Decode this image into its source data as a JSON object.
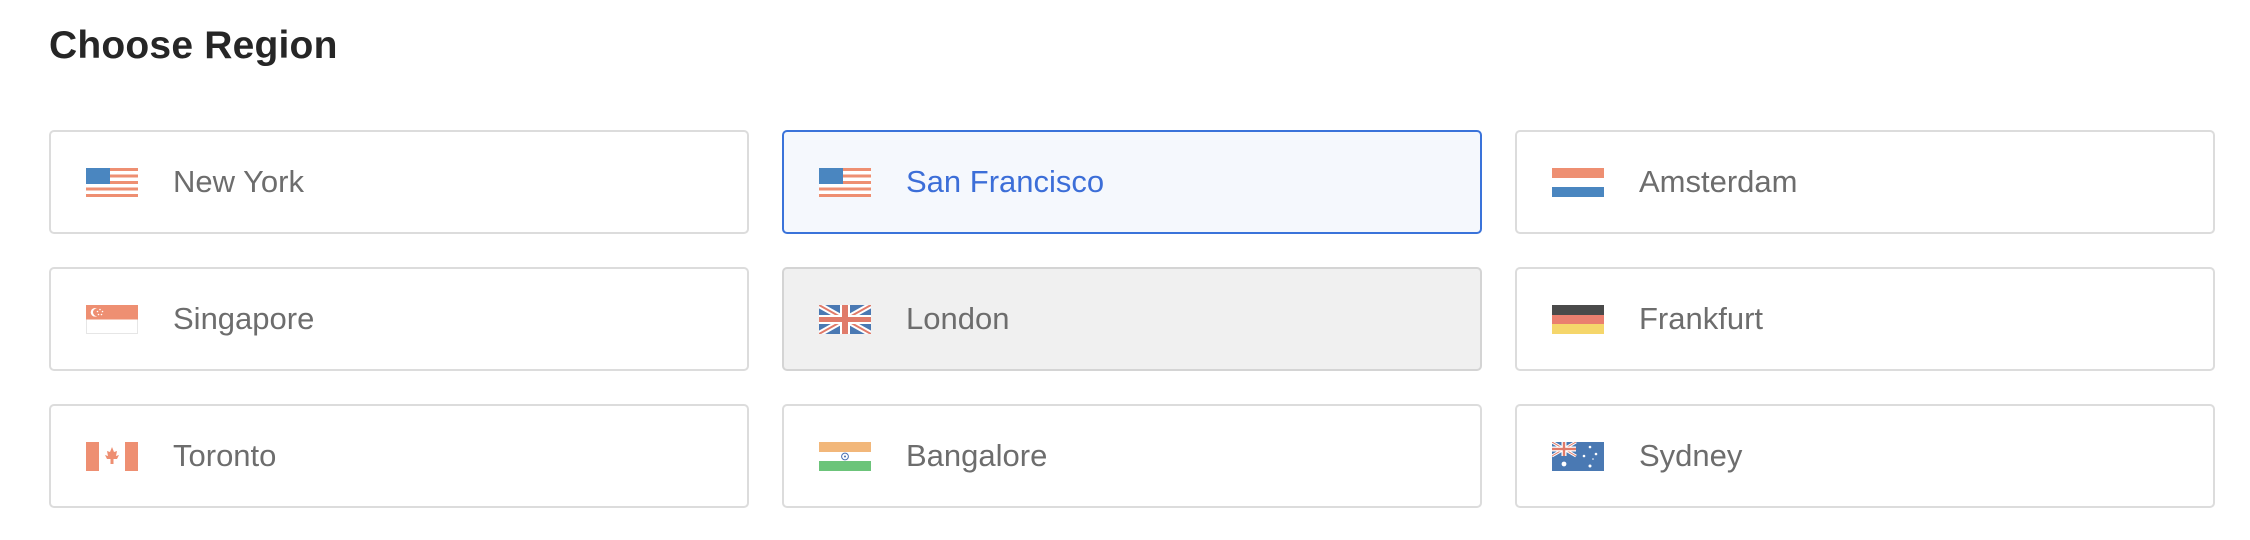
{
  "page": {
    "title": "Choose Region"
  },
  "regions": [
    {
      "label": "New York",
      "flag": "us-flag-icon",
      "state": "default"
    },
    {
      "label": "San Francisco",
      "flag": "us-flag-icon",
      "state": "selected"
    },
    {
      "label": "Amsterdam",
      "flag": "netherlands-flag-icon",
      "state": "default"
    },
    {
      "label": "Singapore",
      "flag": "singapore-flag-icon",
      "state": "default"
    },
    {
      "label": "London",
      "flag": "uk-flag-icon",
      "state": "disabled"
    },
    {
      "label": "Frankfurt",
      "flag": "germany-flag-icon",
      "state": "default"
    },
    {
      "label": "Toronto",
      "flag": "canada-flag-icon",
      "state": "default"
    },
    {
      "label": "Bangalore",
      "flag": "india-flag-icon",
      "state": "default"
    },
    {
      "label": "Sydney",
      "flag": "australia-flag-icon",
      "state": "default"
    }
  ],
  "colors": {
    "selected_border": "#3a73da",
    "selected_background": "#f5f8fd",
    "selected_text": "#3c6ed8",
    "disabled_background": "#f0f0f0",
    "default_text": "#6d6d6d",
    "card_border": "#dcdcdc"
  }
}
